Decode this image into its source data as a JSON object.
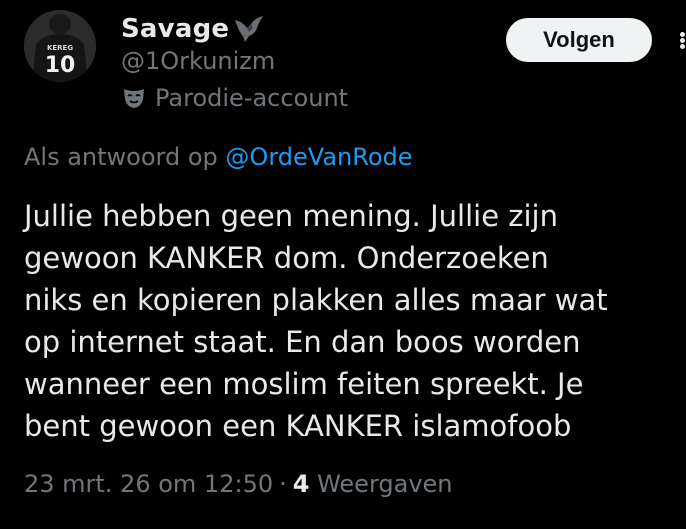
{
  "author": {
    "name": "Savage",
    "handle": "@1Orkunizm",
    "label": "Parodie-account",
    "avatar_shirt_name": "KEREG",
    "avatar_shirt_number": "10"
  },
  "actions": {
    "follow_label": "Volgen"
  },
  "reply": {
    "prefix": "Als antwoord op",
    "to_handle": "@OrdeVanRode"
  },
  "tweet": {
    "text": "Jullie hebben geen mening. Jullie zijn\ngewoon KANKER dom. Onderzoeken\nniks en kopieren plakken alles maar wat\nop internet staat. En dan boos worden\nwanneer een moslim feiten spreekt. Je\nbent gewoon een KANKER islamofoob"
  },
  "meta": {
    "timestamp": "23 mrt. 26 om 12:50",
    "separator": "·",
    "views_count": "4",
    "views_label": "Weergaven"
  },
  "colors": {
    "background": "#000000",
    "text_primary": "#e7e9ea",
    "text_secondary": "#71767b",
    "link": "#1d9bf0",
    "follow_button_bg": "#eff3f4"
  },
  "icons": {
    "name_badge": "eagle-icon",
    "parody": "mask-icon",
    "more": "more-icon"
  }
}
